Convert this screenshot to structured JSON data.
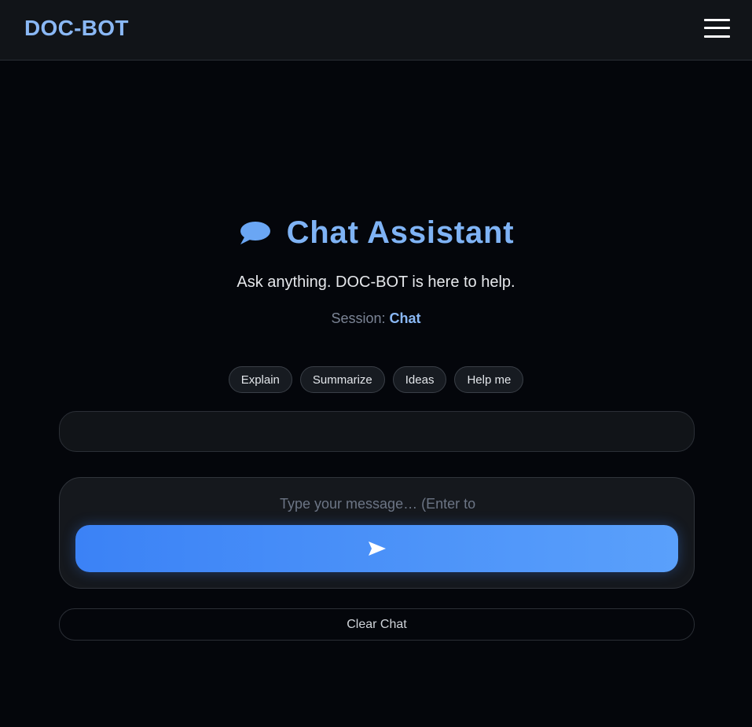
{
  "header": {
    "brand": "DOC-BOT",
    "menu_icon": "hamburger-menu-icon"
  },
  "hero": {
    "icon": "speech-bubble-icon",
    "title": "Chat Assistant",
    "subtitle": "Ask anything. DOC-BOT is here to help.",
    "session_label": "Session:",
    "session_value": "Chat"
  },
  "chips": [
    {
      "label": "Explain"
    },
    {
      "label": "Summarize"
    },
    {
      "label": "Ideas"
    },
    {
      "label": "Help me"
    }
  ],
  "composer": {
    "placeholder": "Type your message… (Enter to send)",
    "value": "",
    "send_icon": "send-arrow-icon"
  },
  "actions": {
    "clear_label": "Clear Chat"
  },
  "colors": {
    "background": "#04060b",
    "topbar": "#111418",
    "accent": "#8ab8f5",
    "button_start": "#3b82f6",
    "button_end": "#5aa0fb"
  }
}
